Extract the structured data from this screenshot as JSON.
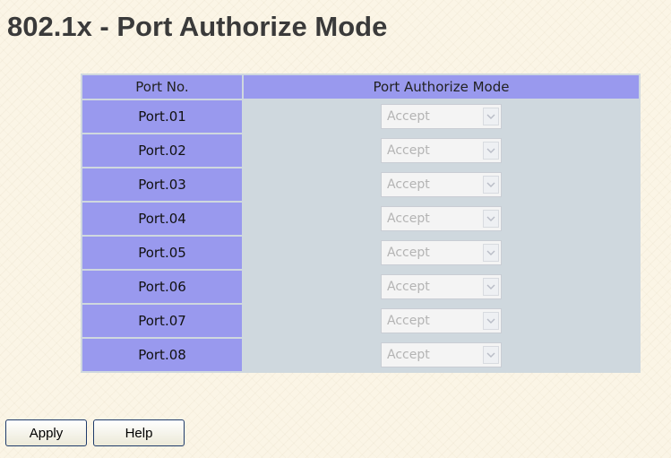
{
  "page": {
    "title": "802.1x - Port Authorize Mode"
  },
  "table": {
    "headers": {
      "port_no": "Port No.",
      "mode": "Port Authorize Mode"
    },
    "rows": [
      {
        "port": "Port.01",
        "mode": "Accept"
      },
      {
        "port": "Port.02",
        "mode": "Accept"
      },
      {
        "port": "Port.03",
        "mode": "Accept"
      },
      {
        "port": "Port.04",
        "mode": "Accept"
      },
      {
        "port": "Port.05",
        "mode": "Accept"
      },
      {
        "port": "Port.06",
        "mode": "Accept"
      },
      {
        "port": "Port.07",
        "mode": "Accept"
      },
      {
        "port": "Port.08",
        "mode": "Accept"
      }
    ]
  },
  "buttons": {
    "apply": "Apply",
    "help": "Help"
  },
  "icons": {
    "dropdown": "chevron-down-icon"
  },
  "colors": {
    "header_bg": "#9999ee",
    "page_bg": "#fbf5e6",
    "disabled_text": "#b4b4b4"
  }
}
